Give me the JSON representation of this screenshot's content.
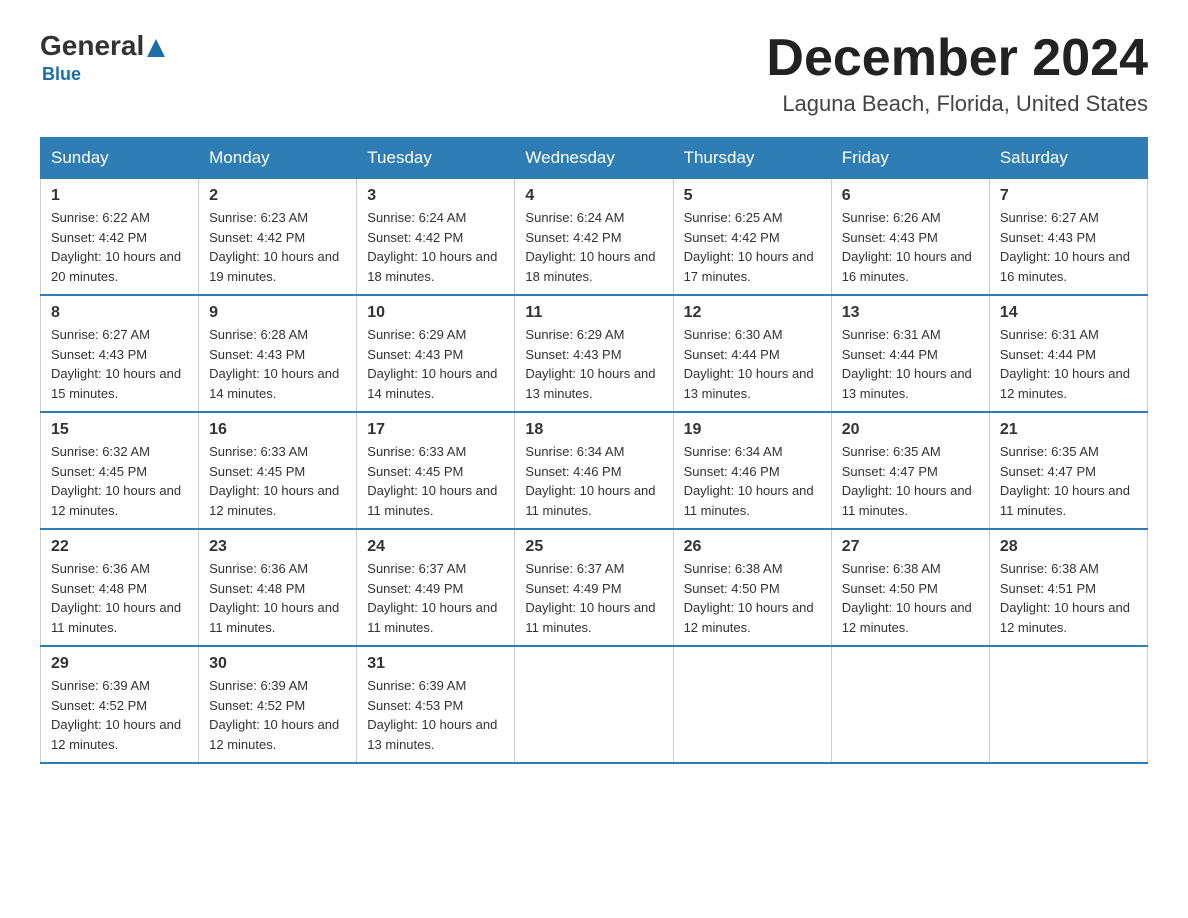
{
  "logo": {
    "general": "General",
    "blue": "Blue"
  },
  "header": {
    "title": "December 2024",
    "subtitle": "Laguna Beach, Florida, United States"
  },
  "weekdays": [
    "Sunday",
    "Monday",
    "Tuesday",
    "Wednesday",
    "Thursday",
    "Friday",
    "Saturday"
  ],
  "weeks": [
    [
      {
        "day": "1",
        "sunrise": "6:22 AM",
        "sunset": "4:42 PM",
        "daylight": "10 hours and 20 minutes."
      },
      {
        "day": "2",
        "sunrise": "6:23 AM",
        "sunset": "4:42 PM",
        "daylight": "10 hours and 19 minutes."
      },
      {
        "day": "3",
        "sunrise": "6:24 AM",
        "sunset": "4:42 PM",
        "daylight": "10 hours and 18 minutes."
      },
      {
        "day": "4",
        "sunrise": "6:24 AM",
        "sunset": "4:42 PM",
        "daylight": "10 hours and 18 minutes."
      },
      {
        "day": "5",
        "sunrise": "6:25 AM",
        "sunset": "4:42 PM",
        "daylight": "10 hours and 17 minutes."
      },
      {
        "day": "6",
        "sunrise": "6:26 AM",
        "sunset": "4:43 PM",
        "daylight": "10 hours and 16 minutes."
      },
      {
        "day": "7",
        "sunrise": "6:27 AM",
        "sunset": "4:43 PM",
        "daylight": "10 hours and 16 minutes."
      }
    ],
    [
      {
        "day": "8",
        "sunrise": "6:27 AM",
        "sunset": "4:43 PM",
        "daylight": "10 hours and 15 minutes."
      },
      {
        "day": "9",
        "sunrise": "6:28 AM",
        "sunset": "4:43 PM",
        "daylight": "10 hours and 14 minutes."
      },
      {
        "day": "10",
        "sunrise": "6:29 AM",
        "sunset": "4:43 PM",
        "daylight": "10 hours and 14 minutes."
      },
      {
        "day": "11",
        "sunrise": "6:29 AM",
        "sunset": "4:43 PM",
        "daylight": "10 hours and 13 minutes."
      },
      {
        "day": "12",
        "sunrise": "6:30 AM",
        "sunset": "4:44 PM",
        "daylight": "10 hours and 13 minutes."
      },
      {
        "day": "13",
        "sunrise": "6:31 AM",
        "sunset": "4:44 PM",
        "daylight": "10 hours and 13 minutes."
      },
      {
        "day": "14",
        "sunrise": "6:31 AM",
        "sunset": "4:44 PM",
        "daylight": "10 hours and 12 minutes."
      }
    ],
    [
      {
        "day": "15",
        "sunrise": "6:32 AM",
        "sunset": "4:45 PM",
        "daylight": "10 hours and 12 minutes."
      },
      {
        "day": "16",
        "sunrise": "6:33 AM",
        "sunset": "4:45 PM",
        "daylight": "10 hours and 12 minutes."
      },
      {
        "day": "17",
        "sunrise": "6:33 AM",
        "sunset": "4:45 PM",
        "daylight": "10 hours and 11 minutes."
      },
      {
        "day": "18",
        "sunrise": "6:34 AM",
        "sunset": "4:46 PM",
        "daylight": "10 hours and 11 minutes."
      },
      {
        "day": "19",
        "sunrise": "6:34 AM",
        "sunset": "4:46 PM",
        "daylight": "10 hours and 11 minutes."
      },
      {
        "day": "20",
        "sunrise": "6:35 AM",
        "sunset": "4:47 PM",
        "daylight": "10 hours and 11 minutes."
      },
      {
        "day": "21",
        "sunrise": "6:35 AM",
        "sunset": "4:47 PM",
        "daylight": "10 hours and 11 minutes."
      }
    ],
    [
      {
        "day": "22",
        "sunrise": "6:36 AM",
        "sunset": "4:48 PM",
        "daylight": "10 hours and 11 minutes."
      },
      {
        "day": "23",
        "sunrise": "6:36 AM",
        "sunset": "4:48 PM",
        "daylight": "10 hours and 11 minutes."
      },
      {
        "day": "24",
        "sunrise": "6:37 AM",
        "sunset": "4:49 PM",
        "daylight": "10 hours and 11 minutes."
      },
      {
        "day": "25",
        "sunrise": "6:37 AM",
        "sunset": "4:49 PM",
        "daylight": "10 hours and 11 minutes."
      },
      {
        "day": "26",
        "sunrise": "6:38 AM",
        "sunset": "4:50 PM",
        "daylight": "10 hours and 12 minutes."
      },
      {
        "day": "27",
        "sunrise": "6:38 AM",
        "sunset": "4:50 PM",
        "daylight": "10 hours and 12 minutes."
      },
      {
        "day": "28",
        "sunrise": "6:38 AM",
        "sunset": "4:51 PM",
        "daylight": "10 hours and 12 minutes."
      }
    ],
    [
      {
        "day": "29",
        "sunrise": "6:39 AM",
        "sunset": "4:52 PM",
        "daylight": "10 hours and 12 minutes."
      },
      {
        "day": "30",
        "sunrise": "6:39 AM",
        "sunset": "4:52 PM",
        "daylight": "10 hours and 12 minutes."
      },
      {
        "day": "31",
        "sunrise": "6:39 AM",
        "sunset": "4:53 PM",
        "daylight": "10 hours and 13 minutes."
      },
      null,
      null,
      null,
      null
    ]
  ]
}
